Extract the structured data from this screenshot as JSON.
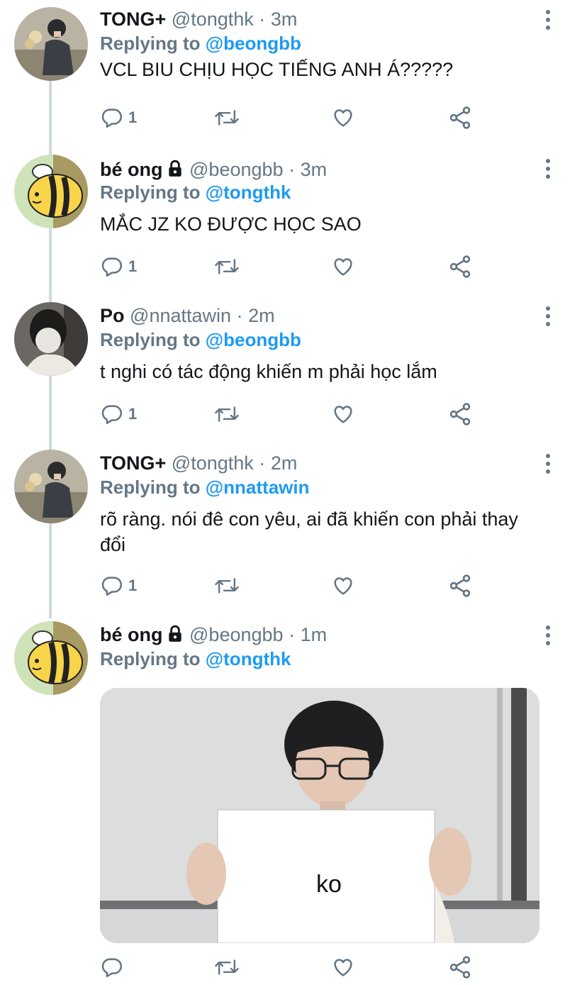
{
  "tweets": [
    {
      "name": "TONG+",
      "handle": "@tongthk",
      "dot": "·",
      "time": "3m",
      "replying_label": "Replying to",
      "replying_to": "@beongbb",
      "text": "VCL BIU CHỊU HỌC TIẾNG ANH Á?????",
      "reply_count": "1"
    },
    {
      "name": "bé ong",
      "handle": "@beongbb",
      "dot": "·",
      "time": "3m",
      "replying_label": "Replying to",
      "replying_to": "@tongthk",
      "text": "MẮC JZ KO ĐƯỢC HỌC SAO",
      "reply_count": "1"
    },
    {
      "name": "Po",
      "handle": "@nnattawin",
      "dot": "·",
      "time": "2m",
      "replying_label": "Replying to",
      "replying_to": "@beongbb",
      "text": "t nghi có tác động khiến m phải học lắm",
      "reply_count": "1"
    },
    {
      "name": "TONG+",
      "handle": "@tongthk",
      "dot": "·",
      "time": "2m",
      "replying_label": "Replying to",
      "replying_to": "@nnattawin",
      "text": "rõ ràng. nói đê con yêu, ai đã khiến con phải thay đổi",
      "reply_count": "1"
    },
    {
      "name": "bé ong",
      "handle": "@beongbb",
      "dot": "·",
      "time": "1m",
      "replying_label": "Replying to",
      "replying_to": "@tongthk",
      "media_sign_text": "ko",
      "reply_count": ""
    }
  ],
  "icons": {
    "reply": "reply-icon",
    "retweet": "retweet-icon",
    "like": "heart-icon",
    "share": "share-icon",
    "more": "more-vertical-icon",
    "lock": "lock-icon"
  },
  "colors": {
    "accent": "#1d9bf0",
    "secondary_text": "#657786",
    "thread_line": "#cfd9de"
  }
}
